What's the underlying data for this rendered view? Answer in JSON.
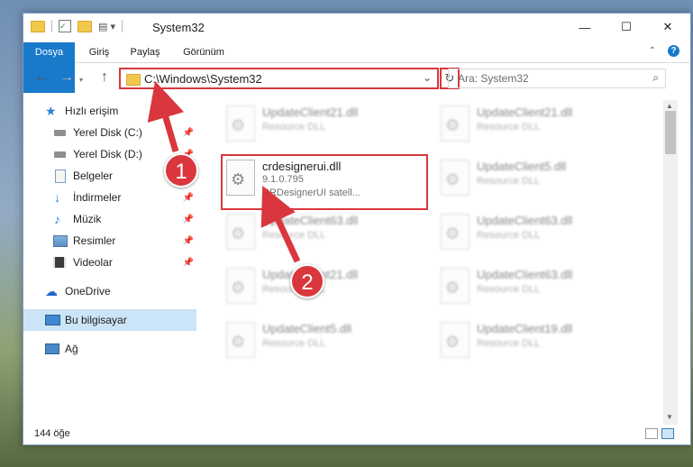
{
  "window": {
    "title": "System32",
    "controls": {
      "minimize": "—",
      "maximize": "☐",
      "close": "✕"
    }
  },
  "ribbon": {
    "tabs": [
      "Dosya",
      "Giriş",
      "Paylaş",
      "Görünüm"
    ],
    "help": "?"
  },
  "nav": {
    "back": "←",
    "forward": "→",
    "up": "↑",
    "address": "C:\\Windows\\System32",
    "dropdown": "⌄",
    "refresh": "↻",
    "search_placeholder": "Ara: System32"
  },
  "sidebar": {
    "items": [
      {
        "label": "Hızlı erişim",
        "icon": "star-icon"
      },
      {
        "label": "Yerel Disk (C:)",
        "icon": "drive-icon",
        "pinned": true
      },
      {
        "label": "Yerel Disk (D:)",
        "icon": "drive-icon",
        "pinned": true
      },
      {
        "label": "Belgeler",
        "icon": "documents-icon",
        "pinned": true
      },
      {
        "label": "İndirmeler",
        "icon": "download-icon",
        "pinned": true
      },
      {
        "label": "Müzik",
        "icon": "music-icon",
        "pinned": true
      },
      {
        "label": "Resimler",
        "icon": "pictures-icon",
        "pinned": true
      },
      {
        "label": "Videolar",
        "icon": "video-icon",
        "pinned": true
      },
      {
        "label": "OneDrive",
        "icon": "cloud-icon"
      },
      {
        "label": "Bu bilgisayar",
        "icon": "computer-icon",
        "selected": true
      },
      {
        "label": "Ağ",
        "icon": "network-icon"
      }
    ]
  },
  "files": [
    {
      "name": "UpdateClient21.dll",
      "desc": "Resource DLL"
    },
    {
      "name": "UpdateClient21.dll",
      "desc": "Resource DLL"
    },
    {
      "name": "crdesignerui.dll",
      "version": "9.1.0.795",
      "desc": "CRDesignerUI satell...",
      "highlighted": true
    },
    {
      "name": "UpdateClient5.dll",
      "desc": "Resource DLL"
    },
    {
      "name": "UpdateClient63.dll",
      "desc": "Resource DLL"
    },
    {
      "name": "UpdateClient63.dll",
      "desc": "Resource DLL"
    },
    {
      "name": "UpdateClient21.dll",
      "desc": "Resource DLL"
    },
    {
      "name": "UpdateClient63.dll",
      "desc": "Resource DLL"
    },
    {
      "name": "UpdateClient5.dll",
      "desc": "Resource DLL"
    },
    {
      "name": "UpdateClient19.dll",
      "desc": "Resource DLL"
    }
  ],
  "status": {
    "item_count": "144 öğe"
  },
  "callouts": [
    "1",
    "2"
  ],
  "colors": {
    "accent": "#1979ca",
    "highlight": "#d9373d",
    "selected": "#cce4f7"
  }
}
